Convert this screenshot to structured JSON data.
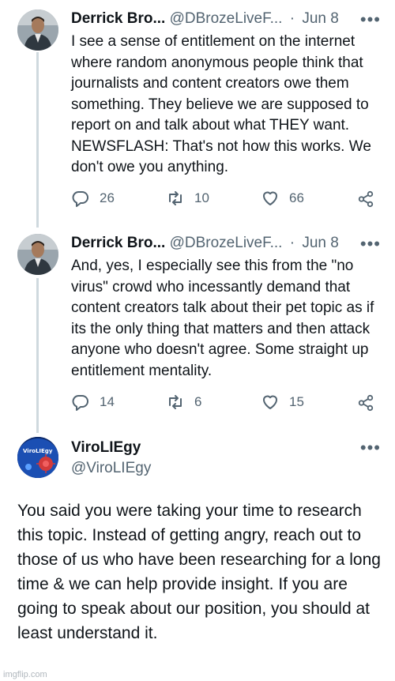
{
  "tweets": [
    {
      "name": "Derrick Bro...",
      "handle": "@DBrozeLiveF...",
      "separator": "·",
      "date": "Jun 8",
      "more": "•••",
      "body": "I see a sense of entitlement on the internet where random anonymous people think that journalists and content creators owe them something. They believe we are supposed to report on and talk about what THEY want. NEWSFLASH: That's not how this works. We don't owe you anything.",
      "replies": "26",
      "retweets": "10",
      "likes": "66"
    },
    {
      "name": "Derrick Bro...",
      "handle": "@DBrozeLiveF...",
      "separator": "·",
      "date": "Jun 8",
      "more": "•••",
      "body": "And, yes, I especially see this from the \"no virus\" crowd who incessantly demand that content creators talk about their pet topic as if its the only thing that matters and then attack anyone who doesn't agree. Some straight up entitlement mentality.",
      "replies": "14",
      "retweets": "6",
      "likes": "15"
    }
  ],
  "reply": {
    "name": "ViroLIEgy",
    "handle": "@ViroLIEgy",
    "more": "•••",
    "avatar_text": "ViroLIEgy",
    "body": "You said you were taking your time to research this topic. Instead of getting angry, reach out to those of us who have been researching for a long time & we can help provide insight. If you are going to speak about our position, you should at least understand it."
  },
  "watermark": "imgflip.com",
  "colors": {
    "text": "#0f1419",
    "secondary": "#536471",
    "thread_line": "#cfd9de"
  }
}
